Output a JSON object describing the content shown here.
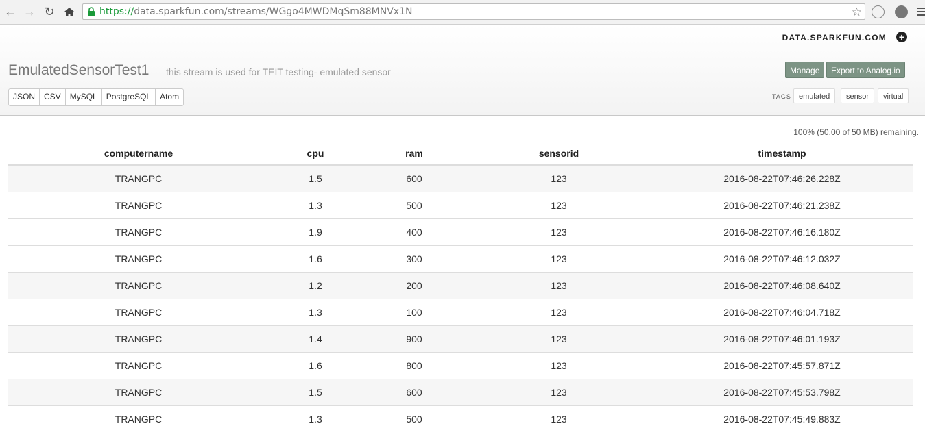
{
  "browser": {
    "url_scheme": "https://",
    "url_rest": "data.sparkfun.com/streams/WGgo4MWDMqSm88MNVx1N"
  },
  "header": {
    "brand": "DATA.SPARKFUN.COM",
    "title": "EmulatedSensorTest1",
    "description": "this stream is used for TEIT testing- emulated sensor",
    "formats": [
      "JSON",
      "CSV",
      "MySQL",
      "PostgreSQL",
      "Atom"
    ],
    "manage_label": "Manage",
    "export_label": "Export to Analog.io",
    "tags_label": "TAGS",
    "tags": [
      "emulated",
      "sensor",
      "virtual"
    ]
  },
  "storage": {
    "remaining": "100% (50.00 of 50 MB) remaining."
  },
  "table": {
    "columns": [
      "computername",
      "cpu",
      "ram",
      "sensorid",
      "timestamp"
    ],
    "rows": [
      [
        "TRANGPC",
        "1.5",
        "600",
        "123",
        "2016-08-22T07:46:26.228Z"
      ],
      [
        "TRANGPC",
        "1.3",
        "500",
        "123",
        "2016-08-22T07:46:21.238Z"
      ],
      [
        "TRANGPC",
        "1.9",
        "400",
        "123",
        "2016-08-22T07:46:16.180Z"
      ],
      [
        "TRANGPC",
        "1.6",
        "300",
        "123",
        "2016-08-22T07:46:12.032Z"
      ],
      [
        "TRANGPC",
        "1.2",
        "200",
        "123",
        "2016-08-22T07:46:08.640Z"
      ],
      [
        "TRANGPC",
        "1.3",
        "100",
        "123",
        "2016-08-22T07:46:04.718Z"
      ],
      [
        "TRANGPC",
        "1.4",
        "900",
        "123",
        "2016-08-22T07:46:01.193Z"
      ],
      [
        "TRANGPC",
        "1.6",
        "800",
        "123",
        "2016-08-22T07:45:57.871Z"
      ],
      [
        "TRANGPC",
        "1.5",
        "600",
        "123",
        "2016-08-22T07:45:53.798Z"
      ],
      [
        "TRANGPC",
        "1.3",
        "500",
        "123",
        "2016-08-22T07:45:49.883Z"
      ]
    ]
  }
}
